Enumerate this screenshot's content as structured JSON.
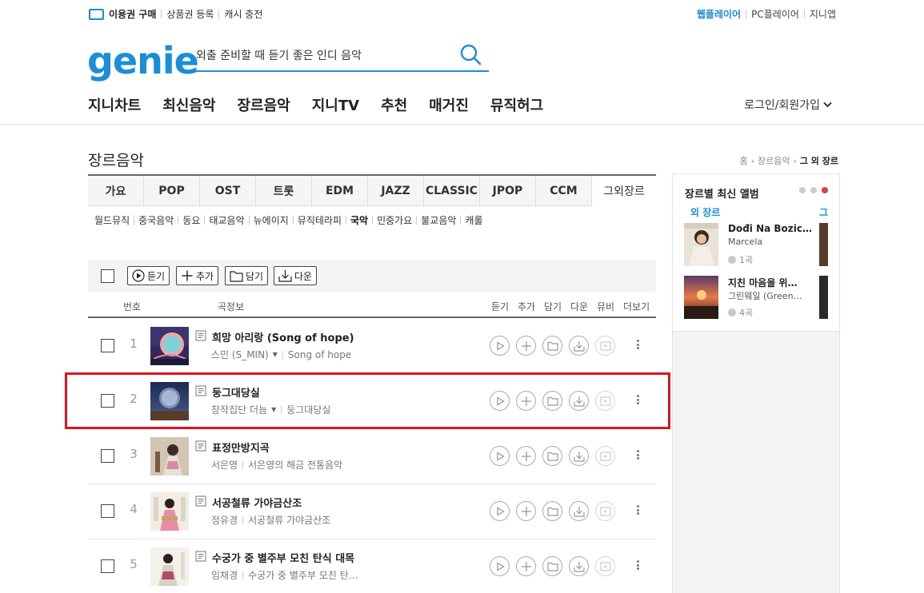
{
  "util": {
    "buy": "이용권 구매",
    "voucher": "상품권 등록",
    "cash": "캐시 충전",
    "web_player": "웹플레이어",
    "pc_player": "PC플레이어",
    "genie_app": "지니앱"
  },
  "logo": "genie",
  "search": {
    "placeholder": "외출 준비할 때 듣기 좋은 인디 음악"
  },
  "gnb": [
    "지니차트",
    "최신음악",
    "장르음악",
    "지니TV",
    "추천",
    "매거진",
    "뮤직허그"
  ],
  "login": "로그인/회원가입",
  "page_title": "장르음악",
  "breadcrumb": {
    "home": "홈",
    "genre": "장르음악",
    "current": "그 외 장르"
  },
  "tabs": [
    "가요",
    "POP",
    "OST",
    "트롯",
    "EDM",
    "JAZZ",
    "CLASSIC",
    "JPOP",
    "CCM",
    "그외장르"
  ],
  "subgenres": [
    "월드뮤직",
    "중국음악",
    "동요",
    "태교음악",
    "뉴에이지",
    "뮤직테라피",
    "국악",
    "민중가요",
    "불교음악",
    "캐롤"
  ],
  "subgenre_active": "국악",
  "toolbar": {
    "listen": "듣기",
    "add": "추가",
    "save": "담기",
    "download": "다운"
  },
  "columns": {
    "no": "번호",
    "info": "곡정보",
    "listen": "듣기",
    "add": "추가",
    "save": "담기",
    "download": "다운",
    "mv": "뮤비",
    "more": "더보기"
  },
  "tracks": [
    {
      "no": "1",
      "title": "희망 아리랑 (Song of hope)",
      "artist": "스민 (S_MIN)",
      "album": "Song of hope",
      "has_dropdown": true
    },
    {
      "no": "2",
      "title": "둥그대당실",
      "artist": "창작집단 더늠",
      "album": "둥그대당실",
      "has_dropdown": true
    },
    {
      "no": "3",
      "title": "표정만방지곡",
      "artist": "서은영",
      "album": "서은영의 해금 전통음악",
      "has_dropdown": false
    },
    {
      "no": "4",
      "title": "서공철류 가야금산조",
      "artist": "정유경",
      "album": "서공철류 가야금산조",
      "has_dropdown": false
    },
    {
      "no": "5",
      "title": "수궁가 중 별주부 모친 탄식 대목",
      "artist": "임채경",
      "album": "수궁가 중 별주부 모친 탄…",
      "has_dropdown": false
    }
  ],
  "side": {
    "title": "장르별 최신 앨범",
    "category": "외 장르",
    "category_next": "그",
    "albums": [
      {
        "title": "Dođi Na Bozic…",
        "artist": "Marcela",
        "count": "1곡"
      },
      {
        "title": "지친 마음을 위…",
        "artist": "그린웨일 (Green…",
        "count": "4곡"
      }
    ]
  },
  "colors": {
    "accent": "#1a8fd8",
    "highlight": "#e0141e",
    "dot_active": "#e53a4b"
  }
}
